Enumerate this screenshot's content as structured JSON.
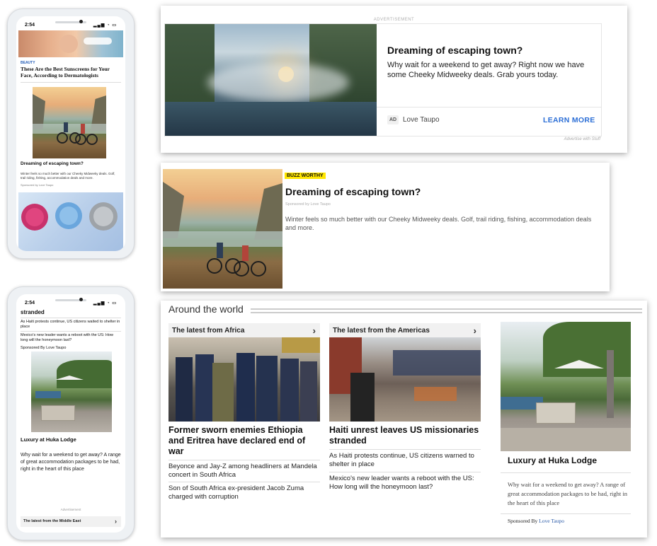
{
  "phone1": {
    "time": "2:54",
    "tag": "BEAUTY",
    "headline": "These Are the Best Sunscreens for Your Face, According to Dermatologists",
    "promo_title": "Dreaming of escaping town?",
    "promo_body": "Winter feels so much better with our Cheeky Midweeky deals. Golf, trail riding, fishing, accommodation deals and more.",
    "sponsor": "Sponsored by Love Taupo"
  },
  "ad_card": {
    "label": "ADVERTISEMENT",
    "title": "Dreaming of escaping town?",
    "body": "Why wait for a weekend to get away? Right now we have some Cheeky Midweeky deals. Grab yours today.",
    "ad_badge": "AD",
    "advertiser": "Love Taupo",
    "cta": "LEARN MORE",
    "footer": "Advertise with Stuff",
    "colors": {
      "cta": "#2b6ed6",
      "border": "#e5e5e5"
    }
  },
  "buzz_card": {
    "badge": "BUZZ WORTHY",
    "title": "Dreaming of escaping town?",
    "sponsor": "Sponsored by Love Taupo",
    "body": "Winter feels so much better with our Cheeky Midweeky deals. Golf, trail riding, fishing, accommodation deals and more.",
    "colors": {
      "badge_bg": "#ffe600"
    }
  },
  "phone2": {
    "time": "2:54",
    "top_text": "stranded",
    "item1": "As Haiti protests continue, US citizens waited to shelter in place",
    "item2": "Mexico's new leader wants a reboot with the US: How long will the honeymoon last?",
    "sponsor": "Sponsored By Love Taupo",
    "promo_title": "Luxury at Huka Lodge",
    "promo_body": "Why wait for a weekend to get away? A range of great accommodation packages to be had, right in the heart of this place",
    "ad_label": "Advertisement",
    "bottom_bar": "The latest from the Middle East"
  },
  "world": {
    "title": "Around the world",
    "col1": {
      "header": "The latest from Africa",
      "headline": "Former sworn enemies Ethiopia and Eritrea have declared end of war",
      "link1": "Beyonce and Jay-Z among headliners at Mandela concert in South Africa",
      "link2": "Son of South Africa ex-president Jacob Zuma charged with corruption"
    },
    "col2": {
      "header": "The latest from the Americas",
      "headline": "Haiti unrest leaves US missionaries stranded",
      "link1": "As Haiti protests continue, US citizens warned to shelter in place",
      "link2": "Mexico's new leader wants a reboot with the US: How long will the honeymoon last?"
    },
    "col3": {
      "title": "Luxury at Huka Lodge",
      "body": "Why wait for a weekend to get away? A range of great accommodation packages to be had, right in the heart of this place",
      "sponsor_prefix": "Sponsored By",
      "sponsor_link": "Love Taupo"
    }
  }
}
